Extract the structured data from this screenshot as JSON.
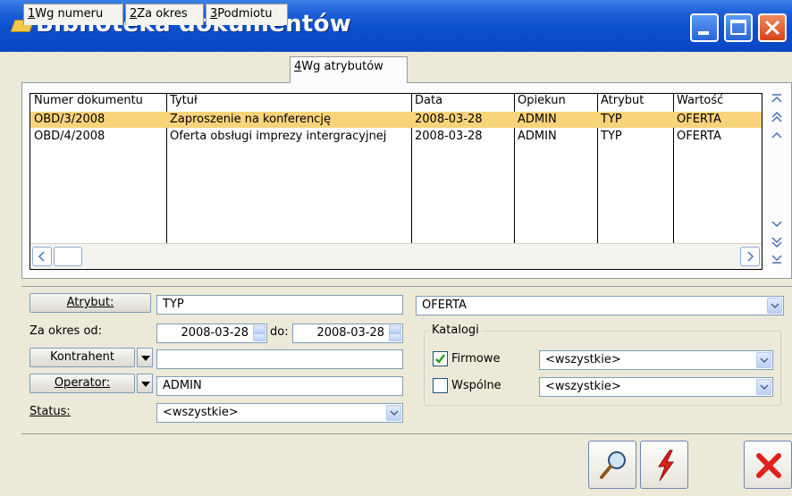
{
  "window": {
    "title": "Biblioteka dokumentów"
  },
  "tabs": [
    {
      "key": "1",
      "label": "Wg numeru"
    },
    {
      "key": "2",
      "label": "Za okres"
    },
    {
      "key": "3",
      "label": "Podmiotu"
    },
    {
      "key": "4",
      "label": "Wg atrybutów"
    }
  ],
  "table": {
    "columns": [
      "Numer dokumentu",
      "Tytuł",
      "Data",
      "Opiekun",
      "Atrybut",
      "Wartość"
    ],
    "rows": [
      [
        "OBD/3/2008",
        "Zaproszenie na konferencję",
        "2008-03-28",
        "ADMIN",
        "TYP",
        "OFERTA"
      ],
      [
        "OBD/4/2008",
        "Oferta obsługi imprezy intergracyjnej",
        "2008-03-28",
        "ADMIN",
        "TYP",
        "OFERTA"
      ]
    ]
  },
  "form": {
    "atrybut_label": "Atrybut:",
    "atrybut_value": "TYP",
    "wartosc_value": "OFERTA",
    "za_okres_label": "Za okres od:",
    "date_from": "2008-03-28",
    "do_label": "do:",
    "date_to": "2008-03-28",
    "kontrahent_label": "Kontrahent",
    "kontrahent_value": "",
    "operator_label": "Operator:",
    "operator_value": "ADMIN",
    "status_label": "Status:",
    "status_value": "<wszystkie>",
    "katalogi": {
      "title": "Katalogi",
      "firmowe_label": "Firmowe",
      "firmowe_checked": true,
      "firmowe_value": "<wszystkie>",
      "wspolne_label": "Wspólne",
      "wspolne_checked": false,
      "wspolne_value": "<wszystkie>"
    }
  },
  "colors": {
    "titlebar": "#0b4fd0",
    "selected_row": "#f7d37a",
    "background": "#ece9d8",
    "check_green": "#21a121",
    "delete_red": "#e0201a"
  }
}
